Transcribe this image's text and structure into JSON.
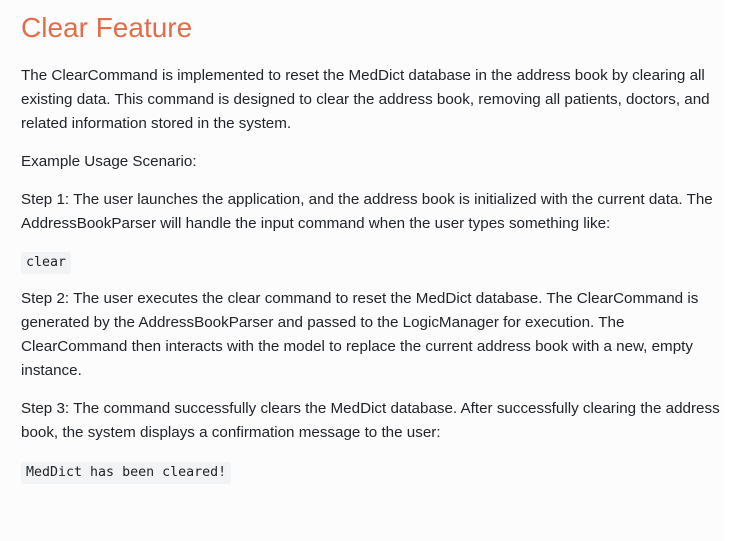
{
  "section": {
    "title": "Clear Feature",
    "paragraphs": {
      "intro": "The ClearCommand is implemented to reset the MedDict database in the address book by clearing all existing data. This command is designed to clear the address book, removing all patients, doctors, and related information stored in the system.",
      "example_heading": "Example Usage Scenario:",
      "step1": "Step 1: The user launches the application, and the address book is initialized with the current data. The AddressBookParser will handle the input command when the user types something like:",
      "step2": "Step 2: The user executes the clear command to reset the MedDict database. The ClearCommand is generated by the AddressBookParser and passed to the LogicManager for execution. The ClearCommand then interacts with the model to replace the current address book with a new, empty instance.",
      "step3": "Step 3: The command successfully clears the MedDict database. After successfully clearing the address book, the system displays a confirmation message to the user:"
    },
    "code": {
      "command": "clear",
      "confirmation": "MedDict has been cleared!"
    }
  },
  "colors": {
    "title": "#e46c4a",
    "text": "#212529",
    "code_bg": "#f1f3f5"
  }
}
